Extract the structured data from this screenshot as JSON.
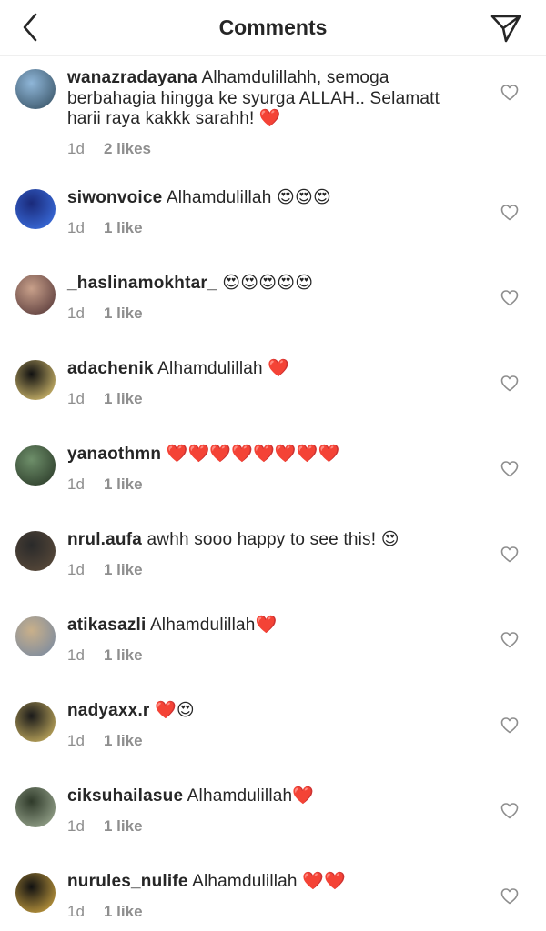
{
  "header": {
    "title": "Comments",
    "back_icon": "chevron-left-icon",
    "share_icon": "paper-plane-icon"
  },
  "comments": [
    {
      "username": "wanazradayana",
      "text": "Alhamdulillahh, semoga berbahagia hingga ke syurga ALLAH.. Selamatt harii raya kakkk sarahh! ❤️",
      "time": "1d",
      "likes": "2 likes",
      "avatar_colors": [
        "#8fb6d8",
        "#3a5568"
      ]
    },
    {
      "username": "siwonvoice",
      "text": "Alhamdulillah 😍😍😍",
      "time": "1d",
      "likes": "1 like",
      "avatar_colors": [
        "#1a2a7a",
        "#3b6fe0"
      ]
    },
    {
      "username": "_haslinamokhtar_",
      "text": "😍😍😍😍😍",
      "time": "1d",
      "likes": "1 like",
      "avatar_colors": [
        "#c8a08a",
        "#5a3b3b"
      ]
    },
    {
      "username": "adachenik",
      "text": "Alhamdulillah ❤️",
      "time": "1d",
      "likes": "1 like",
      "avatar_colors": [
        "#111111",
        "#d8c070"
      ]
    },
    {
      "username": "yanaothmn",
      "text": "❤️❤️❤️❤️❤️❤️❤️❤️",
      "time": "1d",
      "likes": "1 like",
      "avatar_colors": [
        "#6e8f6a",
        "#2c3c2a"
      ]
    },
    {
      "username": "nrul.aufa",
      "text": "awhh sooo happy to see this! 😍",
      "time": "1d",
      "likes": "1 like",
      "avatar_colors": [
        "#2a2a2a",
        "#5a4a3a"
      ]
    },
    {
      "username": "atikasazli",
      "text": "Alhamdulillah❤️",
      "time": "1d",
      "likes": "1 like",
      "avatar_colors": [
        "#c9b08a",
        "#7a8aa0"
      ]
    },
    {
      "username": "nadyaxx.r",
      "text": "❤️😍",
      "time": "1d",
      "likes": "1 like",
      "avatar_colors": [
        "#1a1a1a",
        "#c8b060"
      ]
    },
    {
      "username": "ciksuhailasue",
      "text": "Alhamdulillah❤️",
      "time": "1d",
      "likes": "1 like",
      "avatar_colors": [
        "#2f3a2a",
        "#9aa890"
      ]
    },
    {
      "username": "nurules_nulife",
      "text": "Alhamdulillah ❤️❤️",
      "time": "1d",
      "likes": "1 like",
      "avatar_colors": [
        "#111111",
        "#c8a040"
      ]
    }
  ]
}
